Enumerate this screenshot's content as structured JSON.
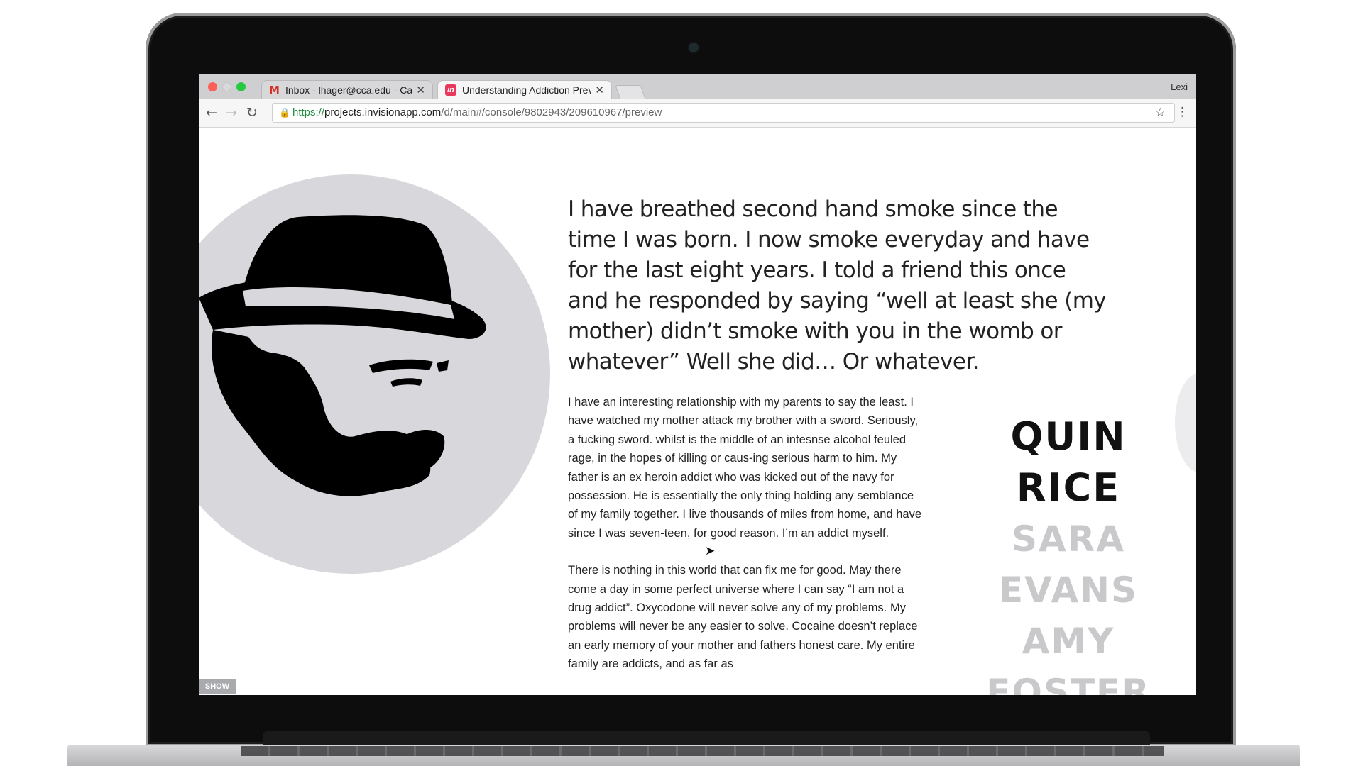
{
  "browser": {
    "tabs": [
      {
        "label": "Inbox - lhager@cca.edu - Cali",
        "icon": "gmail-icon"
      },
      {
        "label": "Understanding Addiction Prev",
        "icon": "invision-icon"
      }
    ],
    "close_glyph": "✕",
    "profile": "Lexi",
    "url_secure": "https://",
    "url_domain": "projects.invisionapp.com",
    "url_path": "/d/main#/console/9802943/209610967/preview"
  },
  "page": {
    "quote": "I have breathed second hand smoke since the time I was born. I now smoke everyday and have for the last eight years. I told a friend this once and he responded by saying “well at least she (my mother) didn’t smoke with you in the womb or whatever” Well she did… Or whatever.",
    "paragraphs": [
      "I have an interesting relationship with my parents to say the least. I have watched my mother attack my brother with a sword. Seriously, a fucking sword. whilst is the middle of an intesnse alcohol feuled rage, in the hopes of killing or caus-ing serious harm to him. My father is an ex heroin addict who was kicked out of the navy for possession. He is essentially the only thing holding any semblance of my family together. I live thousands of miles from home, and have since I was seven-teen, for good reason. I’m an addict myself.",
      "There is nothing in this world that can fix me for good. May there come a day in some perfect universe where I can say “I am not a drug addict”. Oxycodone will never solve any of my problems. My problems will never be any easier to solve. Cocaine doesn’t replace an early memory of your mother and fathers honest care. My entire family are addicts, and as far as"
    ],
    "names": {
      "active": "QUIN RICE",
      "others": [
        "SARA EVANS",
        "AMY FOSTER"
      ]
    },
    "show_button": "SHOW"
  },
  "colors": {
    "circle": "#d8d7db",
    "name_faded": "#c9c9cc",
    "secure_green": "#1e8e3e"
  }
}
